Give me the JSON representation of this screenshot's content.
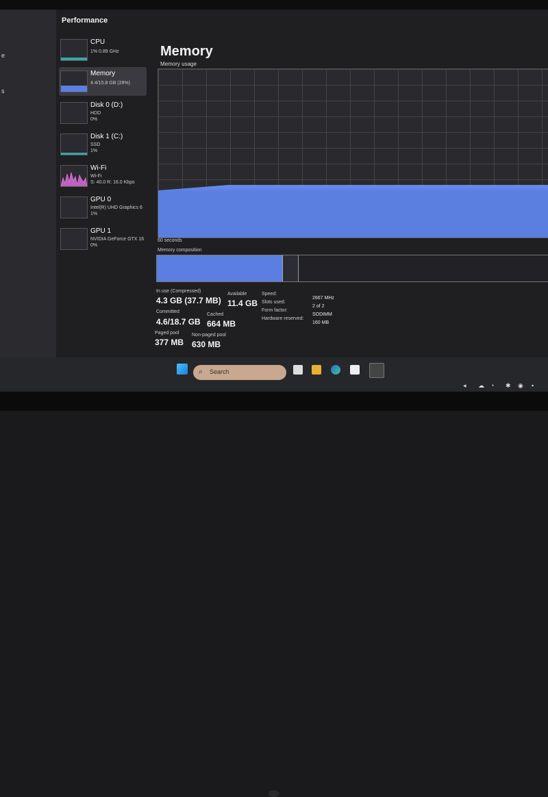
{
  "leftnav": {
    "items": [
      {
        "label": "e"
      },
      {
        "label": "s"
      }
    ]
  },
  "window": {
    "title": "Performance"
  },
  "perf_list": [
    {
      "name": "CPU",
      "sub1": "1% 0.89 GHz",
      "sub2": "",
      "sub3": ""
    },
    {
      "name": "Memory",
      "sub1": "4.4/15.8 GB (28%)",
      "sub2": "",
      "sub3": ""
    },
    {
      "name": "Disk 0 (D:)",
      "sub1": "HDD",
      "sub2": "0%",
      "sub3": ""
    },
    {
      "name": "Disk 1 (C:)",
      "sub1": "SSD",
      "sub2": "1%",
      "sub3": ""
    },
    {
      "name": "Wi-Fi",
      "sub1": "Wi-Fi",
      "sub2": "S: 40.0 R: 16.0 Kbps",
      "sub3": ""
    },
    {
      "name": "GPU 0",
      "sub1": "Intel(R) UHD Graphics 6",
      "sub2": "1%",
      "sub3": ""
    },
    {
      "name": "GPU 1",
      "sub1": "NVIDIA GeForce GTX 16",
      "sub2": "0%",
      "sub3": ""
    }
  ],
  "main": {
    "title": "Memory",
    "usage_label": "Memory usage",
    "seconds_label": "60 seconds",
    "composition_label": "Memory composition",
    "usage_fraction": 0.28
  },
  "stats": {
    "in_use_label": "In use (Compressed)",
    "in_use_value": "4.3 GB (37.7 MB)",
    "available_label": "Available",
    "available_value": "11.4 GB",
    "committed_label": "Committed",
    "committed_value": "4.6/18.7 GB",
    "cached_label": "Cached",
    "cached_value": "664 MB",
    "paged_label": "Paged pool",
    "paged_value": "377 MB",
    "nonpaged_label": "Non-paged pool",
    "nonpaged_value": "630 MB",
    "speed_label": "Speed:",
    "speed_value": "2667 MHz",
    "slots_label": "Slots used:",
    "slots_value": "2 of 2",
    "form_label": "Form factor:",
    "form_value": "SODIMM",
    "hwres_label": "Hardware reserved:",
    "hwres_value": "160 MB"
  },
  "taskbar": {
    "search_placeholder": "Search"
  },
  "colors": {
    "accent": "#5b7fe0",
    "cpu_graph": "#3aa5a5",
    "wifi_graph": "#c060c0"
  }
}
